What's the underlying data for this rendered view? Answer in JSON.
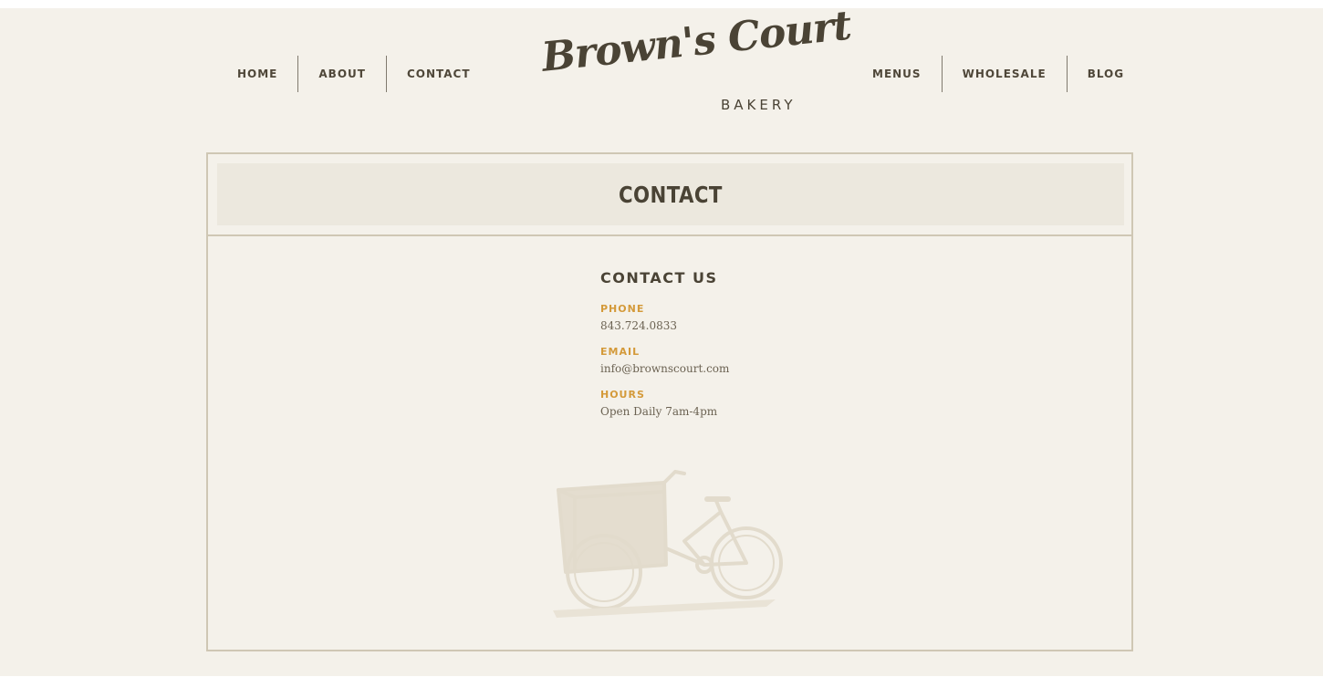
{
  "nav": {
    "left": [
      "HOME",
      "ABOUT",
      "CONTACT"
    ],
    "right": [
      "MENUS",
      "WHOLESALE",
      "BLOG"
    ]
  },
  "logo": {
    "script": "Brown's Court",
    "sub": "BAKERY"
  },
  "page": {
    "title": "CONTACT"
  },
  "contact": {
    "heading": "CONTACT US",
    "phone_label": "PHONE",
    "phone": "843.724.0833",
    "email_label": "EMAIL",
    "email": "info@brownscourt.com",
    "hours_label": "HOURS",
    "hours": "Open Daily 7am-4pm"
  },
  "colors": {
    "background": "#f4f1ea",
    "text": "#4a4335",
    "accent": "#d49a3a",
    "border": "#cfc7b4"
  },
  "icons": {
    "illustration": "bicycle-cart-icon"
  }
}
